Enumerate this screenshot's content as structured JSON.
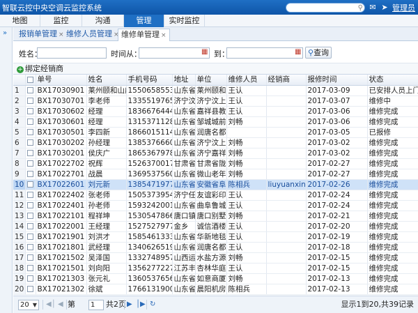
{
  "app": {
    "title": "智联云控中央空调云监控系统",
    "user_label": "管理员"
  },
  "nav": {
    "items": [
      "地图",
      "监控",
      "沟通",
      "管理",
      "实时监控"
    ],
    "active": "管理"
  },
  "tabs": [
    {
      "label": "报销单管理",
      "active": false
    },
    {
      "label": "维修人员管理",
      "active": false
    },
    {
      "label": "维修单管理",
      "active": true
    }
  ],
  "filter": {
    "name_label": "姓名：",
    "time_from_label": "时间从：",
    "time_to_label": "到：",
    "name_value": "",
    "from_value": "",
    "to_value": "",
    "query_label": "查询"
  },
  "toolbar": {
    "bind_label": "绑定经销商"
  },
  "table": {
    "columns": [
      "",
      "",
      "单号",
      "姓名",
      "手机号码",
      "地址",
      "单位",
      "维修人员",
      "经销商",
      "报修时间",
      "状态"
    ],
    "rows": [
      [
        "1",
        "BX17030901",
        "莱州颐和山庄",
        "15506585530",
        "山东省潍坊市",
        "莱州颐和山庄",
        "王认",
        "",
        "2017-03-09",
        "已安排人员上门"
      ],
      [
        "2",
        "BX17030701",
        "李老师",
        "13355197650",
        "济宁汶上县",
        "济宁汶上县",
        "王认",
        "",
        "2017-03-07",
        "维修中"
      ],
      [
        "3",
        "BX17030602",
        "经理",
        "18366764440",
        "山东省济宁市",
        "嘉祥县教育局",
        "王认",
        "",
        "2017-03-06",
        "维修完成"
      ],
      [
        "4",
        "BX17030601",
        "经理",
        "13153711287",
        "山东省济宁市",
        "邹城城前镇",
        "刘畅",
        "",
        "2017-03-06",
        "维修完成"
      ],
      [
        "5",
        "BX17030501",
        "李四新",
        "18660151140",
        "山东省济宁市",
        "润唐名都",
        "",
        "",
        "2017-03-05",
        "已报修"
      ],
      [
        "6",
        "BX17030202",
        "孙经理",
        "13853766603",
        "山东省济宁市",
        "济宁汶上县",
        "刘畅",
        "",
        "2017-03-02",
        "维修完成"
      ],
      [
        "7",
        "BX17030201",
        "侯庆广",
        "18653679780",
        "山东省济宁市",
        "济宁嘉祥县",
        "刘畅",
        "",
        "2017-03-02",
        "维修完成"
      ],
      [
        "8",
        "BX17022702",
        "祝辉",
        "15263700172",
        "甘肃省陇南市",
        "甘肃省陇南市",
        "刘畅",
        "",
        "2017-02-27",
        "维修完成"
      ],
      [
        "9",
        "BX17022701",
        "战晨",
        "13695375601",
        "山东省济宁市",
        "微山老年公寓",
        "刘畅",
        "",
        "2017-02-27",
        "维修完成"
      ],
      [
        "10",
        "BX17022601",
        "刘元新",
        "13854719776",
        "山东省济宁市",
        "安徽省阜阳市",
        "陈相兵",
        "liuyuanxin",
        "2017-02-26",
        "维修完成"
      ],
      [
        "11",
        "BX17022402",
        "张老师",
        "15053739540",
        "济宁任城区",
        "友谊彩印",
        "王认",
        "",
        "2017-02-24",
        "维修完成"
      ],
      [
        "12",
        "BX17022401",
        "孙老师",
        "15932420010",
        "山东省济宁市",
        "曲阜鲁城城管局",
        "王认",
        "",
        "2017-02-24",
        "维修完成"
      ],
      [
        "13",
        "BX17022101",
        "程祥坤",
        "15305478660",
        "唐口镇",
        "唐口别墅",
        "刘畅",
        "",
        "2017-02-21",
        "维修完成"
      ],
      [
        "14",
        "BX17022001",
        "王经理",
        "15275279770",
        "金乡",
        "诚信酒楼",
        "王认",
        "",
        "2017-02-20",
        "维修完成"
      ],
      [
        "15",
        "BX17021901",
        "刘洪才",
        "15854613330",
        "山东省济宁市",
        "华新地毯厂",
        "王认",
        "",
        "2017-02-19",
        "维修完成"
      ],
      [
        "16",
        "BX17021801",
        "武经理",
        "13406265190",
        "山东省济宁市",
        "润唐名都",
        "王认",
        "",
        "2017-02-18",
        "维修完成"
      ],
      [
        "17",
        "BX17021502",
        "吴泽国",
        "13327489570",
        "山西运城",
        "水盐方源庭",
        "刘畅",
        "",
        "2017-02-15",
        "维修完成"
      ],
      [
        "18",
        "BX17021501",
        "刘向阳",
        "13562772270",
        "江苏丰县",
        "杏林华庭小区",
        "王认",
        "",
        "2017-02-15",
        "维修完成"
      ],
      [
        "19",
        "BX17021303",
        "张元礼",
        "13605376560",
        "山东省济宁市",
        "如意商厦",
        "刘畅",
        "",
        "2017-02-13",
        "维修完成"
      ],
      [
        "20",
        "BX17021302",
        "徐斌",
        "17661319000",
        "山东省济宁市",
        "晨阳机房",
        "陈相兵",
        "",
        "2017-02-13",
        "维修完成"
      ]
    ],
    "selected_row": 9
  },
  "pager": {
    "page_size": "20",
    "page_prefix": "第",
    "page_value": "1",
    "page_total": "共2页",
    "info": "显示1到20,共39记录"
  },
  "colors": {
    "primary": "#1f6fc4",
    "selected_row": "#cfe2f8",
    "status_ok": "#2e9b3a"
  }
}
